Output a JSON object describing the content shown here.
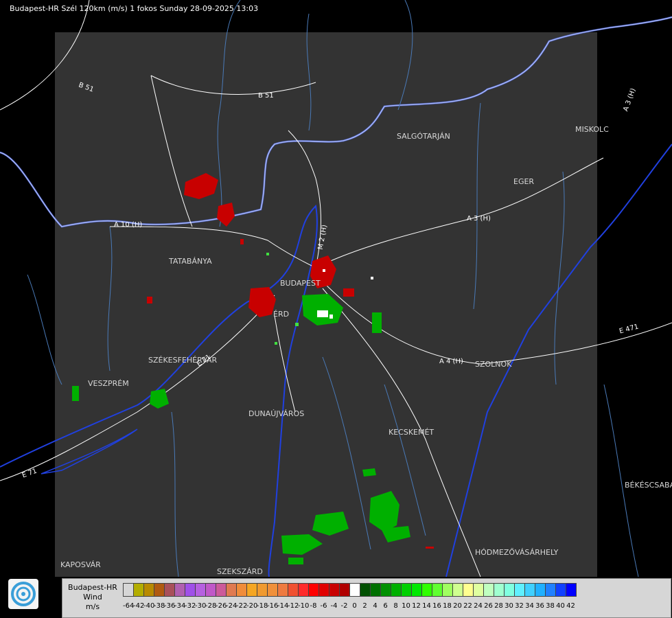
{
  "header": {
    "title": "Budapest-HR Szél 120km (m/s) 1 fokos Sunday 28-09-2025 13:03"
  },
  "cities": {
    "salgotarjan": "SALGÓTARJÁN",
    "miskolc": "MISKOLC",
    "eger": "EGER",
    "tatabanya": "TATABÁNYA",
    "budapest": "BUDAPEST",
    "erd": "ÉRD",
    "szekesfehervar": "SZÉKESFEHÉRVÁR",
    "veszprem": "VESZPRÉM",
    "dunaujvaros": "DUNAÚJVÁROS",
    "kecskemet": "KECSKEMÉT",
    "szolnok": "SZOLNOK",
    "bekescsaba": "BÉKÉSCSABA",
    "hodmezovasarhely": "HÓDMEZŐVÁSÁRHELY",
    "kaposvar": "KAPOSVÁR",
    "szekszard": "SZEKSZÁRD"
  },
  "roads": {
    "b51_west": "B 51",
    "b51_north": "B 51",
    "a10": "A 10 (H)",
    "a3": "A 3 (H)",
    "a3_ne": "A 3 (H)",
    "m2": "M 2 (H)",
    "a4": "A 4 (H)",
    "e71_west": "E 71",
    "e71_center": "E 71",
    "e471": "E 471"
  },
  "legend": {
    "radar_name": "Budapest-HR",
    "quantity": "Wind",
    "unit": "m/s",
    "ticks": [
      "-64",
      "-42",
      "-40",
      "-38",
      "-36",
      "-34",
      "-32",
      "-30",
      "-28",
      "-26",
      "-24",
      "-22",
      "-20",
      "-18",
      "-16",
      "-14",
      "-12",
      "-10",
      "-8",
      "-6",
      "-4",
      "-2",
      "0",
      "2",
      "4",
      "6",
      "8",
      "10",
      "12",
      "14",
      "16",
      "18",
      "20",
      "22",
      "24",
      "26",
      "28",
      "30",
      "32",
      "34",
      "36",
      "38",
      "40",
      "42"
    ],
    "colors": [
      "#d6d6d6",
      "#b3ad00",
      "#b88a00",
      "#b05a10",
      "#a8505a",
      "#b060b0",
      "#a050e8",
      "#b660e0",
      "#c058c8",
      "#cc5a9a",
      "#e07a50",
      "#f08c3a",
      "#f5a623",
      "#f09a30",
      "#f0903a",
      "#ee7a40",
      "#f05030",
      "#ff2a2a",
      "#ff0000",
      "#e00000",
      "#c80000",
      "#b00000",
      "#ffffff",
      "#005000",
      "#007000",
      "#009000",
      "#00b000",
      "#00d000",
      "#00e800",
      "#30ff00",
      "#60ff30",
      "#a0ff60",
      "#d0ff90",
      "#ffff90",
      "#e0ffa0",
      "#c0ffc0",
      "#a0ffd0",
      "#80ffe0",
      "#60f0ff",
      "#40d0ff",
      "#20b0ff",
      "#2080ff",
      "#1040ff",
      "#0000ff"
    ]
  },
  "colors": {
    "background": "#000000",
    "radar_area": "#333333",
    "rivers": "#2030c0",
    "streams": "#4a7ab8",
    "roads": "#ffffff"
  }
}
